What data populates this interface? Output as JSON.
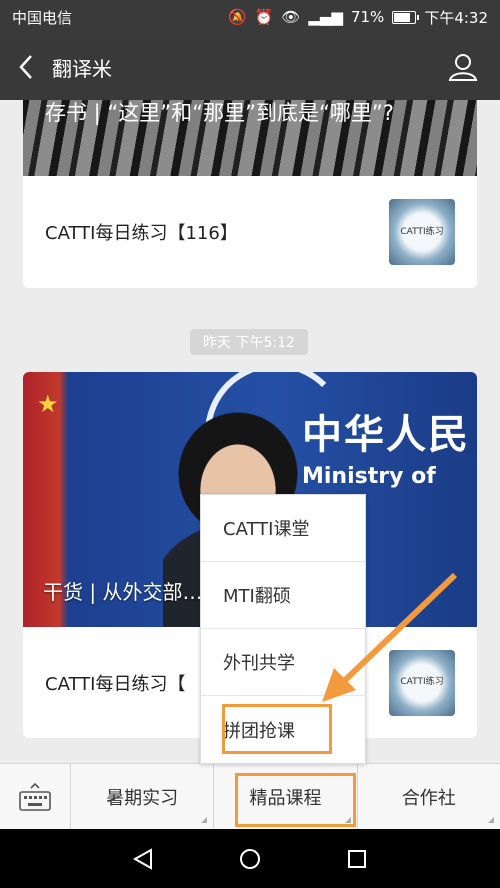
{
  "status_bar": {
    "carrier": "中国电信",
    "battery": "71%",
    "time": "下午4:32"
  },
  "header": {
    "title": "翻译米"
  },
  "messages": [
    {
      "article_title": "存书 | “这里”和“那里”到底是“哪里”?",
      "row_text": "CATTI每日练习【116】",
      "thumb_text": "CATTI练习"
    },
    {
      "article_title": "干货 | 从外交部…同在翻译中的妙用",
      "row_text": "CATTI每日练习【",
      "thumb_text": "CATTI练习"
    }
  ],
  "timestamp": "昨天 下午5:12",
  "image_overlay": {
    "zh": "中华人民",
    "en": "Ministry of"
  },
  "popup_menu": {
    "items": [
      "CATTI课堂",
      "MTI翻硕",
      "外刊共学",
      "拼团抢课"
    ]
  },
  "bottom_menu": {
    "tabs": [
      "暑期实习",
      "精品课程",
      "合作社"
    ]
  },
  "colors": {
    "highlight": "#f39a3c",
    "header_bg": "#393939"
  }
}
